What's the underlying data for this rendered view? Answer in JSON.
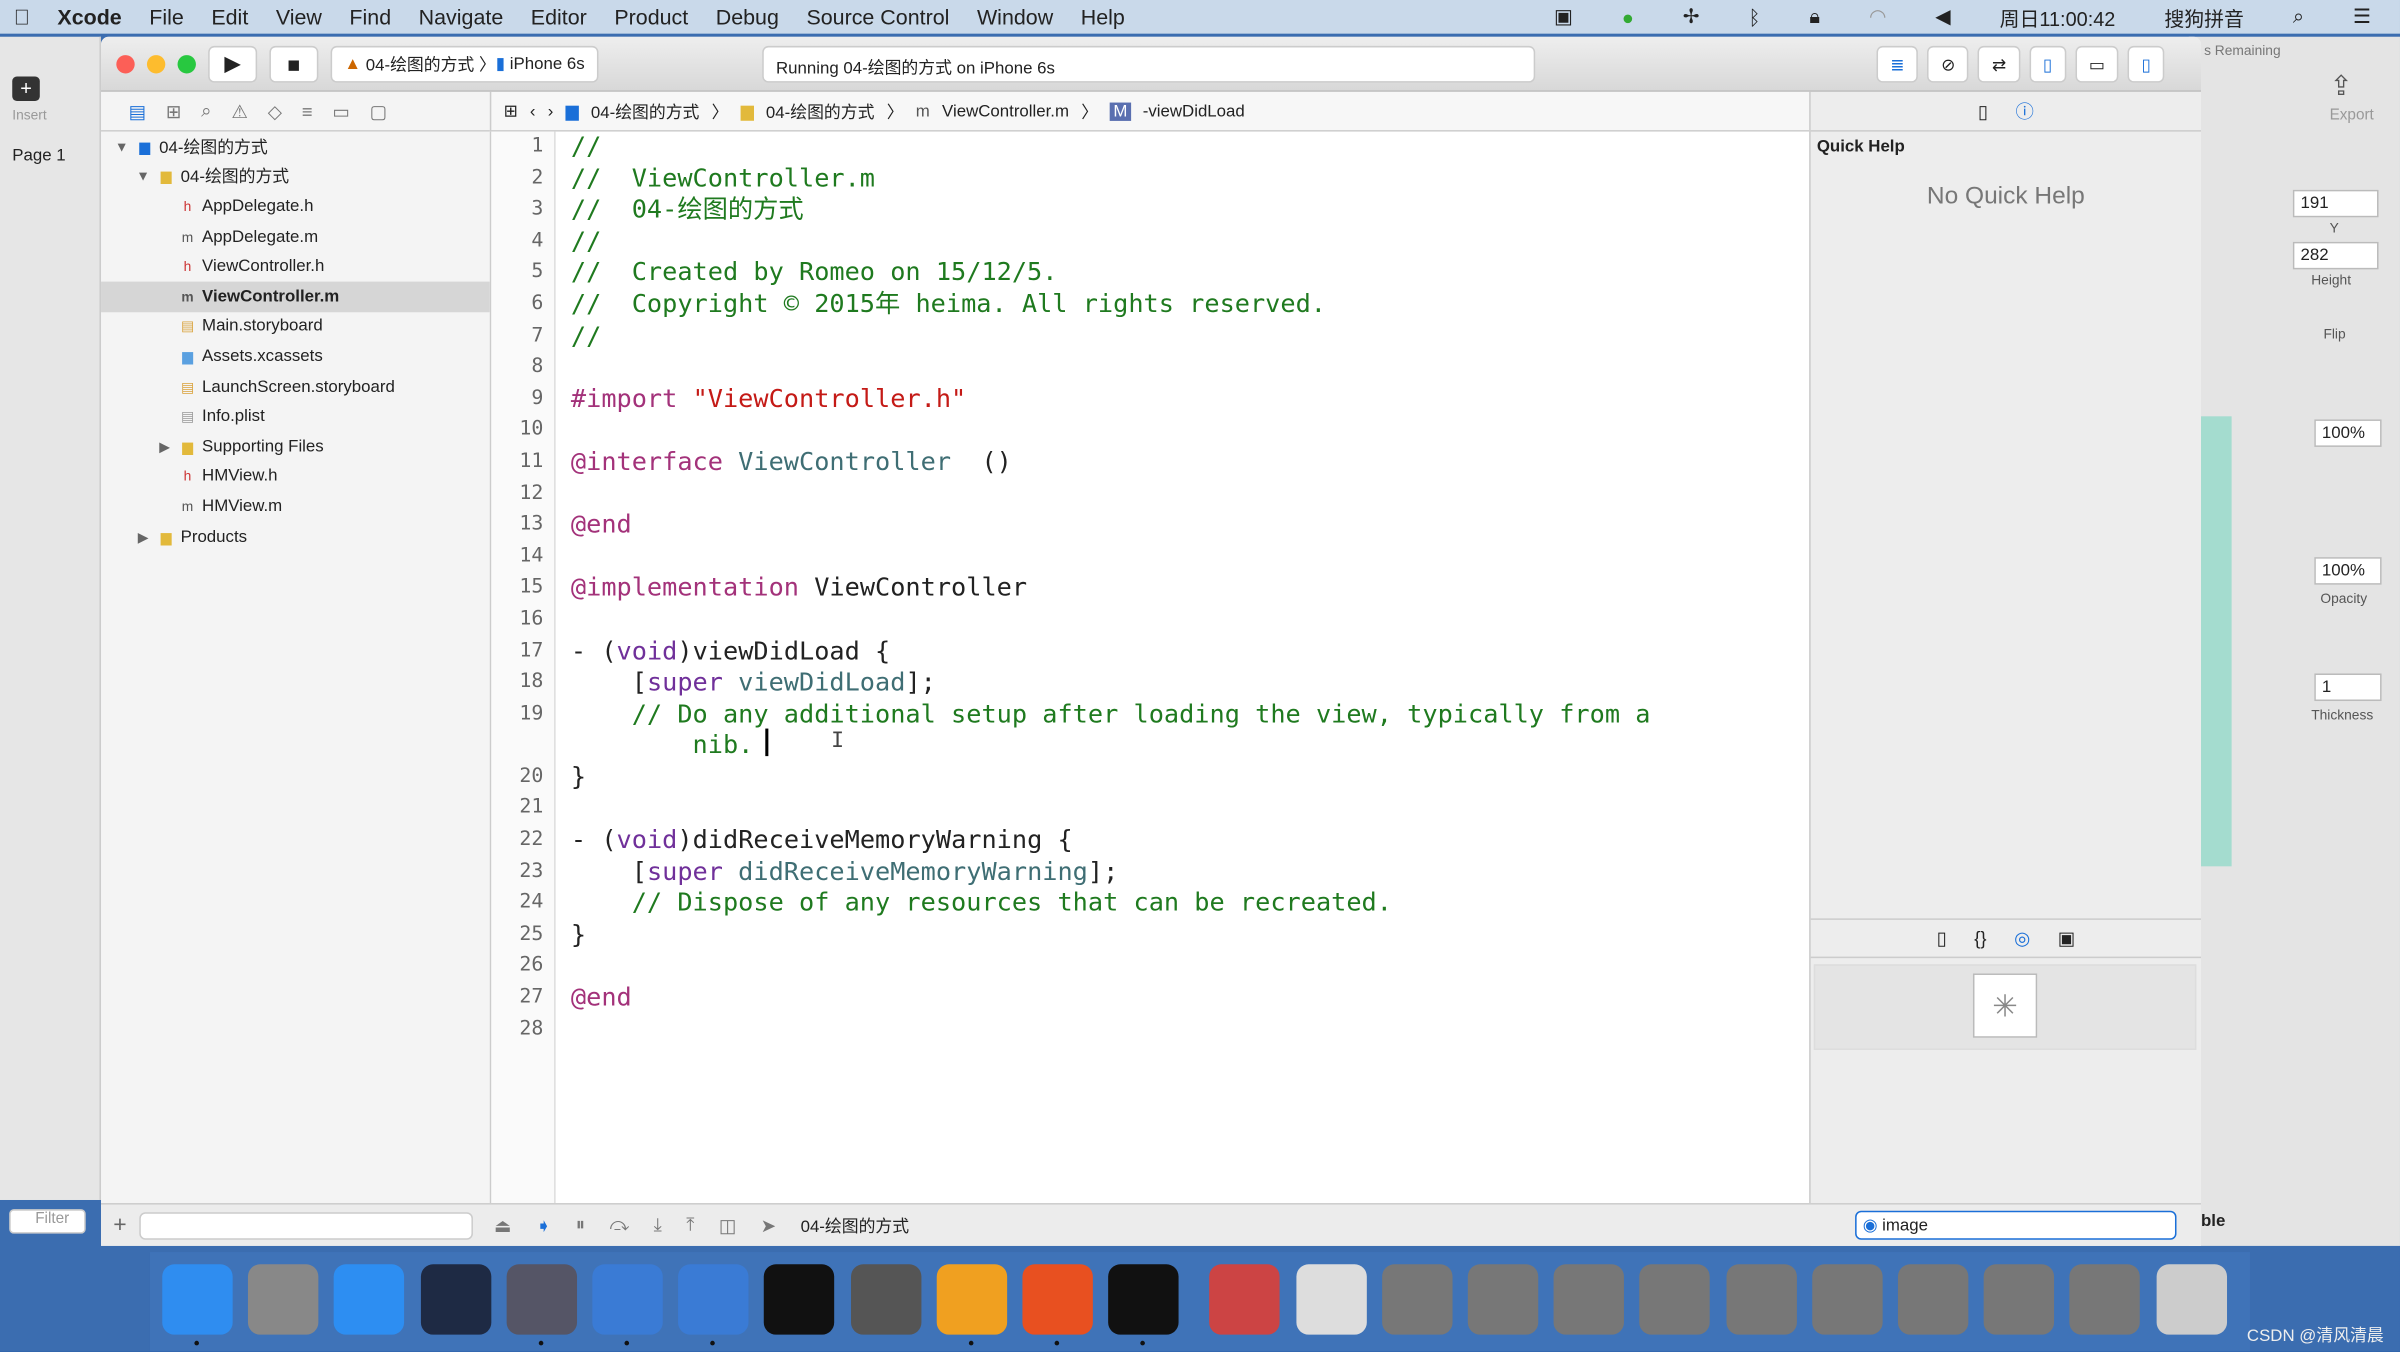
{
  "menubar": {
    "app": "Xcode",
    "items": [
      "File",
      "Edit",
      "View",
      "Find",
      "Navigate",
      "Editor",
      "Product",
      "Debug",
      "Source Control",
      "Window",
      "Help"
    ],
    "clock": "周日11:00:42",
    "ime": "搜狗拼音"
  },
  "toolbar": {
    "scheme": "04-绘图的方式",
    "device": "iPhone 6s",
    "status": "Running 04-绘图的方式 on iPhone 6s"
  },
  "background_app": {
    "insert": "Insert",
    "page": "Page 1",
    "filter": "Filter",
    "remaining": "s Remaining",
    "export": "Export",
    "y_label": "Y",
    "y_value": "191",
    "height_label": "Height",
    "height_value": "282",
    "flip_label": "Flip",
    "pct1": "100%",
    "pct2": "100%",
    "opacity_label": "Opacity",
    "thickness_value": "1",
    "thickness_label": "Thickness",
    "ble": "ble"
  },
  "jumpbar": [
    "04-绘图的方式",
    "04-绘图的方式",
    "ViewController.m",
    "-viewDidLoad"
  ],
  "navigator": [
    {
      "label": "04-绘图的方式",
      "indent": 0,
      "icon": "project",
      "disclosure": "open"
    },
    {
      "label": "04-绘图的方式",
      "indent": 1,
      "icon": "folder",
      "disclosure": "open"
    },
    {
      "label": "AppDelegate.h",
      "indent": 2,
      "icon": "h"
    },
    {
      "label": "AppDelegate.m",
      "indent": 2,
      "icon": "m"
    },
    {
      "label": "ViewController.h",
      "indent": 2,
      "icon": "h"
    },
    {
      "label": "ViewController.m",
      "indent": 2,
      "icon": "m",
      "selected": true
    },
    {
      "label": "Main.storyboard",
      "indent": 2,
      "icon": "storyboard"
    },
    {
      "label": "Assets.xcassets",
      "indent": 2,
      "icon": "assets"
    },
    {
      "label": "LaunchScreen.storyboard",
      "indent": 2,
      "icon": "storyboard"
    },
    {
      "label": "Info.plist",
      "indent": 2,
      "icon": "plist"
    },
    {
      "label": "Supporting Files",
      "indent": 2,
      "icon": "folder",
      "disclosure": "closed"
    },
    {
      "label": "HMView.h",
      "indent": 2,
      "icon": "h"
    },
    {
      "label": "HMView.m",
      "indent": 2,
      "icon": "m"
    },
    {
      "label": "Products",
      "indent": 1,
      "icon": "folder",
      "disclosure": "closed"
    }
  ],
  "code": [
    [
      [
        "c",
        "//"
      ]
    ],
    [
      [
        "c",
        "//  ViewController.m"
      ]
    ],
    [
      [
        "c",
        "//  04-绘图的方式"
      ]
    ],
    [
      [
        "c",
        "//"
      ]
    ],
    [
      [
        "c",
        "//  Created by Romeo on 15/12/5."
      ]
    ],
    [
      [
        "c",
        "//  Copyright © 2015年 heima. All rights reserved."
      ]
    ],
    [
      [
        "c",
        "//"
      ]
    ],
    [],
    [
      [
        "k",
        "#import "
      ],
      [
        "s",
        "\"ViewController.h\""
      ]
    ],
    [],
    [
      [
        "k",
        "@interface "
      ],
      [
        "t",
        "ViewController"
      ],
      [
        "",
        "  ()"
      ]
    ],
    [],
    [
      [
        "k",
        "@end"
      ]
    ],
    [],
    [
      [
        "k",
        "@implementation "
      ],
      [
        "",
        "ViewController"
      ]
    ],
    [],
    [
      [
        "",
        "- ("
      ],
      [
        "p",
        "void"
      ],
      [
        "",
        ")viewDidLoad {"
      ]
    ],
    [
      [
        "",
        "    ["
      ],
      [
        "p",
        "super"
      ],
      [
        "t",
        " viewDidLoad"
      ],
      [
        "",
        "];"
      ]
    ],
    [
      [
        "c",
        "    // Do any additional setup after loading the view, typically from a"
      ]
    ],
    [
      [
        "c",
        "        nib."
      ]
    ],
    [
      [
        "",
        "}"
      ]
    ],
    [],
    [
      [
        "",
        "- ("
      ],
      [
        "p",
        "void"
      ],
      [
        "",
        ")didReceiveMemoryWarning {"
      ]
    ],
    [
      [
        "",
        "    ["
      ],
      [
        "p",
        "super"
      ],
      [
        "t",
        " didReceiveMemoryWarning"
      ],
      [
        "",
        "];"
      ]
    ],
    [
      [
        "c",
        "    // Dispose of any resources that can be recreated."
      ]
    ],
    [
      [
        "",
        "}"
      ]
    ],
    [],
    [
      [
        "k",
        "@end"
      ]
    ],
    []
  ],
  "line_numbers": [
    "1",
    "2",
    "3",
    "4",
    "5",
    "6",
    "7",
    "8",
    "9",
    "10",
    "11",
    "12",
    "13",
    "14",
    "15",
    "16",
    "17",
    "18",
    "19",
    "",
    "20",
    "21",
    "22",
    "23",
    "24",
    "25",
    "26",
    "27",
    "28"
  ],
  "inspector": {
    "title": "Quick Help",
    "empty": "No Quick Help",
    "filter_value": "image"
  },
  "debugbar": {
    "target": "04-绘图的方式"
  },
  "watermark": "CSDN @清风清晨",
  "colors": {
    "comment": "#1f7a1f",
    "keyword": "#a3327a",
    "string": "#c41a16",
    "type": "#3f6e74",
    "dock": "#3f73b8"
  }
}
